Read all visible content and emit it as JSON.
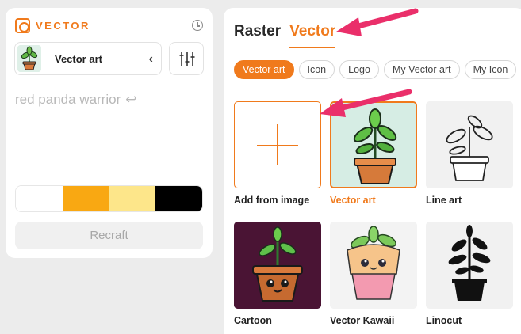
{
  "sidebar": {
    "brand": "VECTOR",
    "style_selector": {
      "name": "Vector art",
      "icon": "potted-plant-thumb"
    },
    "prompt": "red panda warrior",
    "palette": [
      "#ffffff",
      "#f9a812",
      "#fde68a",
      "#000000"
    ],
    "generate_label": "Recraft"
  },
  "main": {
    "tabs": [
      {
        "label": "Raster",
        "active": false
      },
      {
        "label": "Vector",
        "active": true
      }
    ],
    "chips": [
      {
        "label": "Vector art",
        "active": true
      },
      {
        "label": "Icon",
        "active": false
      },
      {
        "label": "Logo",
        "active": false
      },
      {
        "label": "My Vector art",
        "active": false
      },
      {
        "label": "My Icon",
        "active": false
      }
    ],
    "styles": [
      {
        "label": "Add from image"
      },
      {
        "label": "Vector art",
        "selected": true
      },
      {
        "label": "Line art"
      },
      {
        "label": "Cartoon"
      },
      {
        "label": "Vector Kawaii"
      },
      {
        "label": "Linocut"
      }
    ]
  },
  "colors": {
    "accent": "#f07a1c",
    "arrow": "#ea2f6a"
  }
}
